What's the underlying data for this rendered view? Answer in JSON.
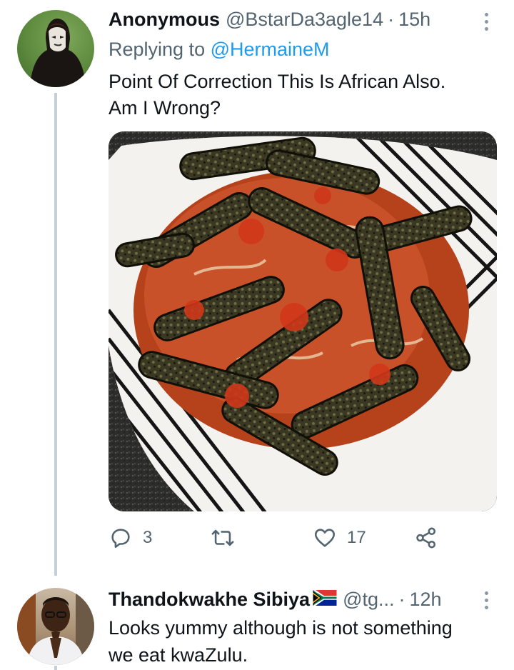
{
  "tweets": [
    {
      "name": "Anonymous",
      "handle": "@BstarDa3agle14",
      "separator": "·",
      "time": "15h",
      "replying_prefix": "Replying to",
      "replying_to": "@HermaineM",
      "text_line1": "Point Of Correction This Is African Also.",
      "text_line2": "Am I Wrong?",
      "stats": {
        "replies": "3",
        "likes": "17"
      },
      "icons": [
        "reply-icon",
        "retweet-icon",
        "like-icon",
        "share-icon",
        "more-icon"
      ]
    },
    {
      "name": "Thandokwakhe Sibiya",
      "flag": "south-africa-flag",
      "handle": "@tg...",
      "separator": "·",
      "time": "12h",
      "text_line1": "Looks yummy although is not something",
      "text_line2": "we eat kwaZulu."
    }
  ],
  "colors": {
    "text": "#0f1419",
    "secondary": "#536471",
    "link": "#1d9bf0",
    "thread_line": "#c4cfd6"
  }
}
